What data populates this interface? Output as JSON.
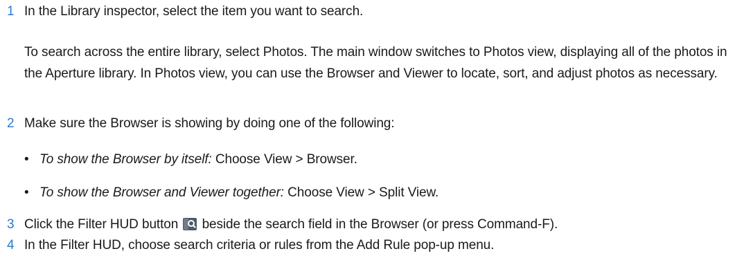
{
  "steps": [
    {
      "number": "1",
      "text": "In the Library inspector, select the item you want to search."
    },
    {
      "number": "2",
      "text": "Make sure the Browser is showing by doing one of the following:"
    },
    {
      "number": "3",
      "text_before_icon": "Click the Filter HUD button",
      "icon": "filter-hud-icon",
      "text_after_icon": "beside the search field in the Browser (or press Command-F)."
    },
    {
      "number": "4",
      "text": "In the Filter HUD, choose search criteria or rules from the Add Rule pop-up menu."
    }
  ],
  "step1_paragraph": "To search across the entire library, select Photos. The main window switches to Photos view, displaying all of the photos in the Aperture library. In Photos view, you can use the Browser and Viewer to locate, sort, and adjust photos as necessary.",
  "bullets": [
    {
      "bullet": "•",
      "label": "To show the Browser by itself:",
      "text": "Choose View > Browser."
    },
    {
      "bullet": "•",
      "label": "To show the Browser and Viewer together:",
      "text": "Choose View > Split View."
    }
  ],
  "colors": {
    "step_number": "#2b7bd1",
    "body_text": "#1a1a1a",
    "icon_bg": "#4d5a6a",
    "icon_glass": "#ffffff"
  }
}
